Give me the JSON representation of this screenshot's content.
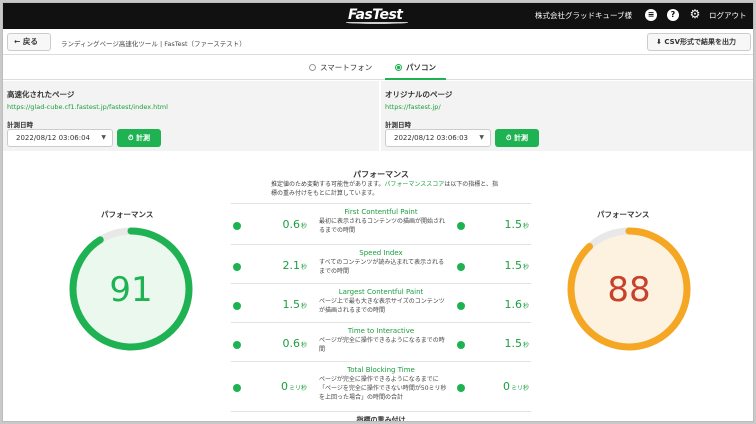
{
  "header": {
    "logo": "FasTest",
    "company": "株式会社グラッドキューブ様",
    "logout": "ログアウト",
    "icons": [
      "list-icon",
      "help-icon",
      "gear-icon"
    ]
  },
  "toolbar": {
    "back_label": "戻る",
    "breadcrumb": "ランディングページ高速化ツール | FasTest（ファーステスト）",
    "csv_label": "CSV形式で結果を出力"
  },
  "device_tabs": [
    {
      "label": "スマートフォン",
      "active": false
    },
    {
      "label": "パソコン",
      "active": true
    }
  ],
  "left_panel": {
    "title": "高速化されたページ",
    "url": "https://glad-cube.cf1.fastest.jp/fastest/index.html",
    "measure_label": "計測日時",
    "datetime": "2022/08/12 03:06:04",
    "measure_button": "計測"
  },
  "right_panel": {
    "title": "オリジナルのページ",
    "url": "https://fastest.jp/",
    "measure_label": "計測日時",
    "datetime": "2022/08/12 03:06:03",
    "measure_button": "計測"
  },
  "gauges": {
    "left": {
      "label": "パフォーマンス",
      "score": 91,
      "color": "#1fb253",
      "fill_color": "#eaf8ee"
    },
    "right": {
      "label": "パフォーマンス",
      "score": 88,
      "color": "#f5a623",
      "fill_color": "#fdf1e0",
      "text_color": "#c8412b"
    }
  },
  "center": {
    "title": "パフォーマンス",
    "desc_1": "推定値のため変動する可能性があります。",
    "desc_link": "パフォーマンススコア",
    "desc_2": "は以下の指標と、指標の重み付けをもとに計算しています。",
    "metrics": [
      {
        "name": "First Contentful Paint",
        "desc": "最初に表示されるコンテンツの描画が開始されるまでの時間",
        "left_value": "0.6",
        "left_unit": "秒",
        "right_value": "1.5",
        "right_unit": "秒"
      },
      {
        "name": "Speed Index",
        "desc": "すべてのコンテンツが読み込まれて表示されるまでの時間",
        "left_value": "2.1",
        "left_unit": "秒",
        "right_value": "1.5",
        "right_unit": "秒"
      },
      {
        "name": "Largest Contentful Paint",
        "desc": "ページ上で最も大きな表示サイズのコンテンツが描画されるまでの時間",
        "left_value": "1.5",
        "left_unit": "秒",
        "right_value": "1.6",
        "right_unit": "秒"
      },
      {
        "name": "Time to Interactive",
        "desc": "ページが完全に操作できるようになるまでの時間",
        "left_value": "0.6",
        "left_unit": "秒",
        "right_value": "1.5",
        "right_unit": "秒"
      },
      {
        "name": "Total Blocking Time",
        "desc": "ページが完全に操作できるようになるまでに「ページを完全に操作できない時間が50ミリ秒を上回った場合」の時間の合計",
        "left_value": "0",
        "left_unit": "ミリ秒",
        "right_value": "0",
        "right_unit": "ミリ秒"
      }
    ],
    "weight_title": "指標の重み付け"
  }
}
